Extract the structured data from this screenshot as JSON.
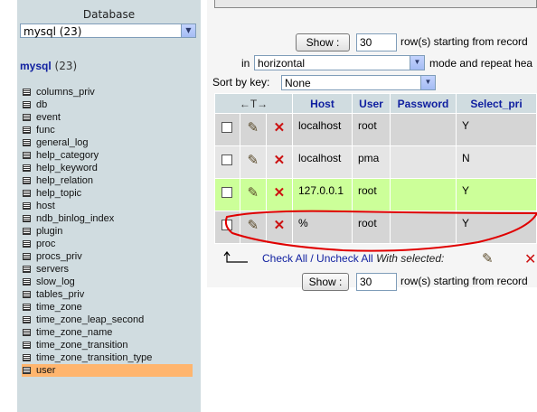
{
  "sidebar": {
    "database_label": "Database",
    "database_select": "mysql (23)",
    "db_name": "mysql",
    "db_count": "(23)",
    "tables": [
      "columns_priv",
      "db",
      "event",
      "func",
      "general_log",
      "help_category",
      "help_keyword",
      "help_relation",
      "help_topic",
      "host",
      "ndb_binlog_index",
      "plugin",
      "proc",
      "procs_priv",
      "servers",
      "slow_log",
      "tables_priv",
      "time_zone",
      "time_zone_leap_second",
      "time_zone_name",
      "time_zone_transition",
      "time_zone_transition_type",
      "user"
    ],
    "active_table": "user"
  },
  "nav": {
    "show_label": "Show :",
    "rows_value": "30",
    "rows_text": "row(s) starting from record",
    "in_label": "in",
    "mode_value": "horizontal",
    "mode_text": "mode and repeat hea",
    "sort_label": "Sort by key:",
    "sort_value": "None"
  },
  "grid": {
    "columns": [
      "Host",
      "User",
      "Password",
      "Select_pri"
    ],
    "rows": [
      {
        "host": "localhost",
        "user": "root",
        "password": "",
        "select_priv": "Y"
      },
      {
        "host": "localhost",
        "user": "pma",
        "password": "",
        "select_priv": "N"
      },
      {
        "host": "127.0.0.1",
        "user": "root",
        "password": "",
        "select_priv": "Y"
      },
      {
        "host": "%",
        "user": "root",
        "password": "",
        "select_priv": "Y"
      }
    ]
  },
  "footer": {
    "check_all": "Check All / Uncheck All",
    "with_selected": "With selected:",
    "show_label": "Show :",
    "rows_value": "30",
    "rows_text": "row(s) starting from record"
  },
  "icons": {
    "edit": "pencil-icon",
    "delete": "delete-x-icon",
    "table": "table-icon",
    "arrow": "check-all-arrow-icon"
  },
  "colors": {
    "sidebar_bg": "#d0dce0",
    "header_text": "#1020a0",
    "highlight_row": "#ccff99",
    "active_table": "#ffb56e",
    "annotation": "#e00000"
  }
}
